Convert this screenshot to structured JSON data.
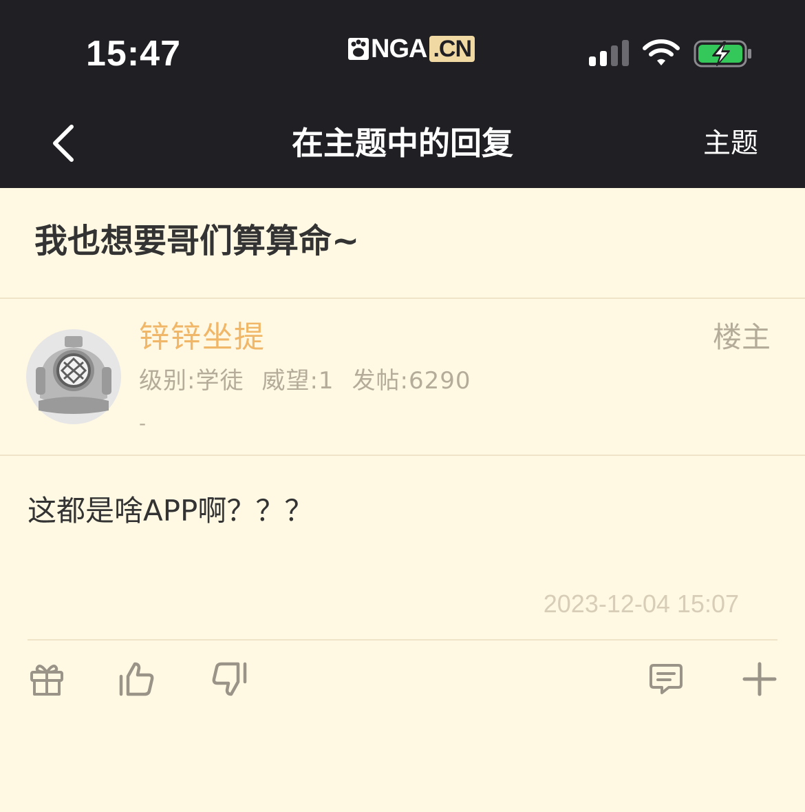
{
  "status_bar": {
    "time": "15:47",
    "logo_text": "NGA",
    "logo_suffix": ".CN",
    "battery_color": "#34c759"
  },
  "nav": {
    "title": "在主题中的回复",
    "right_label": "主题"
  },
  "topic": {
    "title": "我也想要哥们算算命~"
  },
  "author": {
    "name": "锌锌坐提",
    "tag": "楼主",
    "level": "级别:学徒",
    "prestige": "威望:1",
    "posts": "发帖:6290",
    "signature": "-",
    "name_color": "#f0b769"
  },
  "post": {
    "content": "这都是啥APP啊？？？",
    "time": "2023-12-04 15:07"
  },
  "actions": {
    "icons": [
      "gift-icon",
      "thumbs-up-icon",
      "thumbs-down-icon",
      "comment-icon",
      "plus-icon"
    ]
  },
  "colors": {
    "header_bg": "#1f1f24",
    "page_bg": "#fff8e3",
    "muted_text": "#b5ab99"
  }
}
